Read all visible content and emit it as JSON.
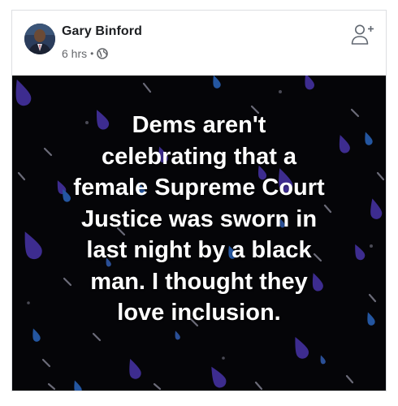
{
  "post": {
    "author_name": "Gary Binford",
    "timestamp": "6 hrs",
    "separator": "•",
    "privacy_icon": "globe-icon",
    "add_friend_icon": "add-friend-icon",
    "avatar": "avatar"
  },
  "image_text": {
    "lines": [
      "Dems aren't",
      "celebrating that a",
      "female Supreme Court",
      "Justice was sworn in",
      "last night by a black",
      "man. I thought they",
      "love inclusion."
    ]
  },
  "colors": {
    "background": "#050508",
    "rain_purple": "#3d2c8f",
    "rain_blue": "#2456a0",
    "rain_streak": "#6b6b78",
    "text": "#ffffff",
    "meta_gray": "#65676b"
  }
}
